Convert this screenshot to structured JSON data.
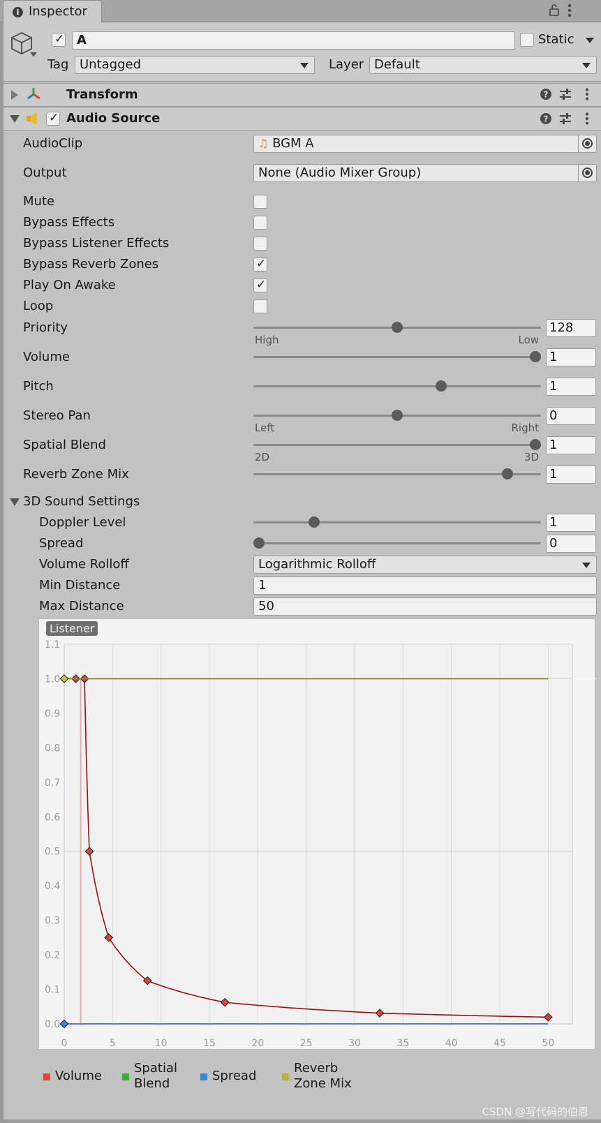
{
  "window": {
    "tab_title": "Inspector"
  },
  "header": {
    "name": "A",
    "static_label": "Static",
    "tag_label": "Tag",
    "tag_value": "Untagged",
    "layer_label": "Layer",
    "layer_value": "Default"
  },
  "transform": {
    "title": "Transform"
  },
  "audio_source": {
    "title": "Audio Source",
    "audioclip_label": "AudioClip",
    "audioclip_value": "BGM A",
    "output_label": "Output",
    "output_value": "None (Audio Mixer Group)",
    "toggles": [
      {
        "label": "Mute",
        "checked": false
      },
      {
        "label": "Bypass Effects",
        "checked": false
      },
      {
        "label": "Bypass Listener Effects",
        "checked": false
      },
      {
        "label": "Bypass Reverb Zones",
        "checked": true
      },
      {
        "label": "Play On Awake",
        "checked": true
      },
      {
        "label": "Loop",
        "checked": false
      }
    ],
    "sliders": [
      {
        "label": "Priority",
        "value": "128",
        "fraction": 0.5,
        "min_label": "High",
        "max_label": "Low"
      },
      {
        "label": "Volume",
        "value": "1",
        "fraction": 1.0,
        "min_label": "",
        "max_label": ""
      },
      {
        "label": "Pitch",
        "value": "1",
        "fraction": 0.66,
        "min_label": "",
        "max_label": ""
      },
      {
        "label": "Stereo Pan",
        "value": "0",
        "fraction": 0.5,
        "min_label": "Left",
        "max_label": "Right"
      },
      {
        "label": "Spatial Blend",
        "value": "1",
        "fraction": 1.0,
        "min_label": "2D",
        "max_label": "3D"
      },
      {
        "label": "Reverb Zone Mix",
        "value": "1",
        "fraction": 0.9,
        "min_label": "",
        "max_label": ""
      }
    ],
    "sound3d": {
      "title": "3D Sound Settings",
      "doppler_label": "Doppler Level",
      "doppler_value": "1",
      "doppler_fraction": 0.2,
      "spread_label": "Spread",
      "spread_value": "0",
      "spread_fraction": 0.0,
      "rolloff_label": "Volume Rolloff",
      "rolloff_value": "Logarithmic Rolloff",
      "min_distance_label": "Min Distance",
      "min_distance_value": "1",
      "max_distance_label": "Max Distance",
      "max_distance_value": "50"
    }
  },
  "chart_data": {
    "type": "line",
    "title": "",
    "tag": "Listener",
    "xlim": [
      0,
      52.5
    ],
    "ylim": [
      0,
      1.1
    ],
    "x_ticks": [
      "0",
      "5",
      "10",
      "15",
      "20",
      "25",
      "30",
      "35",
      "40",
      "45",
      "50"
    ],
    "y_ticks": [
      "0.0",
      "0.1",
      "0.2",
      "0.3",
      "0.4",
      "0.5",
      "0.6",
      "0.7",
      "0.8",
      "0.9",
      "1.0",
      "1.1"
    ],
    "listener_x": 1.7,
    "series": [
      {
        "name": "Volume",
        "color": "#e0463c",
        "points": [
          [
            1.2,
            1.0
          ],
          [
            2.1,
            1.0
          ],
          [
            2.6,
            0.5
          ],
          [
            4.6,
            0.25
          ],
          [
            8.6,
            0.125
          ],
          [
            16.6,
            0.0625
          ],
          [
            32.6,
            0.0312
          ],
          [
            50.0,
            0.0195
          ]
        ]
      },
      {
        "name": "Spatial Blend",
        "color": "#3fae3a",
        "points": [
          [
            0,
            1.0
          ],
          [
            50,
            1.0
          ]
        ]
      },
      {
        "name": "Spread",
        "color": "#3c82e0",
        "points": [
          [
            0,
            0.0
          ],
          [
            50,
            0.0
          ]
        ]
      },
      {
        "name": "Reverb Zone Mix",
        "color": "#b9b43c",
        "points": [
          [
            0,
            1.0
          ],
          [
            50,
            1.0
          ]
        ]
      }
    ],
    "legend": [
      {
        "label": "Volume",
        "color": "#e0463c"
      },
      {
        "label": "Spatial\nBlend",
        "color": "#3fae3a"
      },
      {
        "label": "Spread",
        "color": "#3c82e0"
      },
      {
        "label": "Reverb\nZone Mix",
        "color": "#b9b43c"
      }
    ]
  },
  "watermark": "CSDN @写代码的伯恩"
}
